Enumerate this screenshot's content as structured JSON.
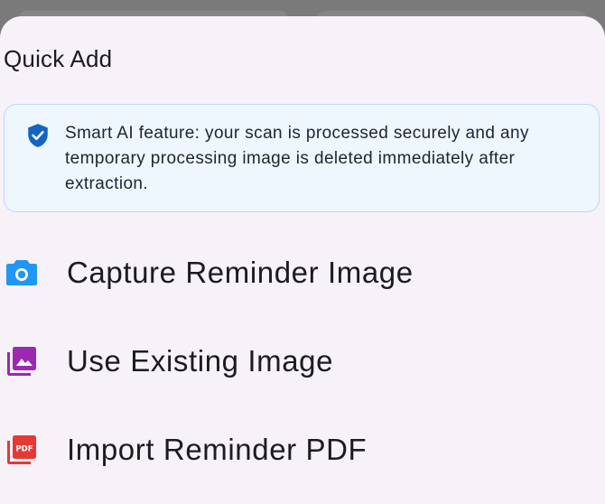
{
  "sheet": {
    "title": "Quick Add"
  },
  "notice": {
    "icon": "shield-check-icon",
    "text": "Smart AI feature: your scan is processed securely and any temporary processing image is deleted immediately after extraction."
  },
  "options": [
    {
      "label": "Capture Reminder Image",
      "icon": "camera-icon",
      "color": "#2196f3"
    },
    {
      "label": "Use Existing Image",
      "icon": "photo-library-icon",
      "color": "#9c27b0"
    },
    {
      "label": "Import Reminder PDF",
      "icon": "pdf-icon",
      "color": "#e53935"
    }
  ],
  "colors": {
    "notice_background": "#eef6fe",
    "notice_border": "#bcd9f6",
    "shield": "#1565c0",
    "sheet_background": "#f7f1f8"
  }
}
